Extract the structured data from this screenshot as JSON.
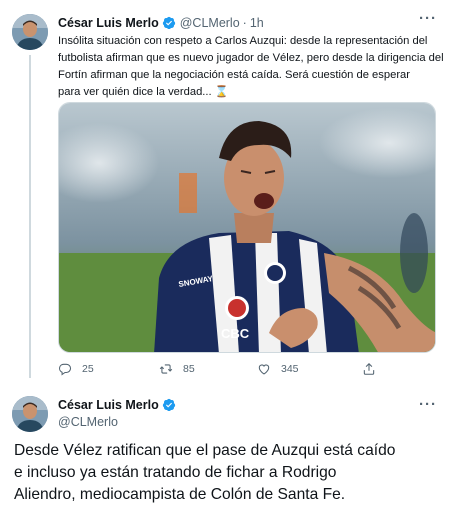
{
  "tweet1": {
    "author_name": "César Luis Merlo",
    "handle": "@CLMerlo",
    "separator": "·",
    "time": "1h",
    "more_label": "···",
    "text_lines": [
      "Insólita situación con respeto a Carlos Auzqui: desde la representación del",
      "futbolista afirman que es nuevo jugador de Vélez, pero desde la dirigencia del",
      "Fortín afirman que la negociación está caída. Será cuestión de esperar",
      "para ver quién dice la verdad... ⌛"
    ],
    "media": {
      "jersey_brand": "SNOWAY",
      "jersey_sponsor": "CBC"
    },
    "actions": {
      "replies": "25",
      "retweets": "85",
      "likes": "345"
    },
    "icons": [
      "verified-badge-icon",
      "reply-icon",
      "retweet-icon",
      "like-icon",
      "share-icon"
    ]
  },
  "tweet2": {
    "author_name": "César Luis Merlo",
    "handle": "@CLMerlo",
    "more_label": "···",
    "text_lines": [
      "Desde Vélez ratifican que el pase de Auzqui está caído",
      "e incluso ya están tratando de fichar a Rodrigo",
      "Aliendro, mediocampista de Colón de Santa Fe."
    ]
  },
  "colors": {
    "text": "#0f1419",
    "secondary": "#536471",
    "verified": "#1d9bf0",
    "line": "#cfd9de"
  }
}
